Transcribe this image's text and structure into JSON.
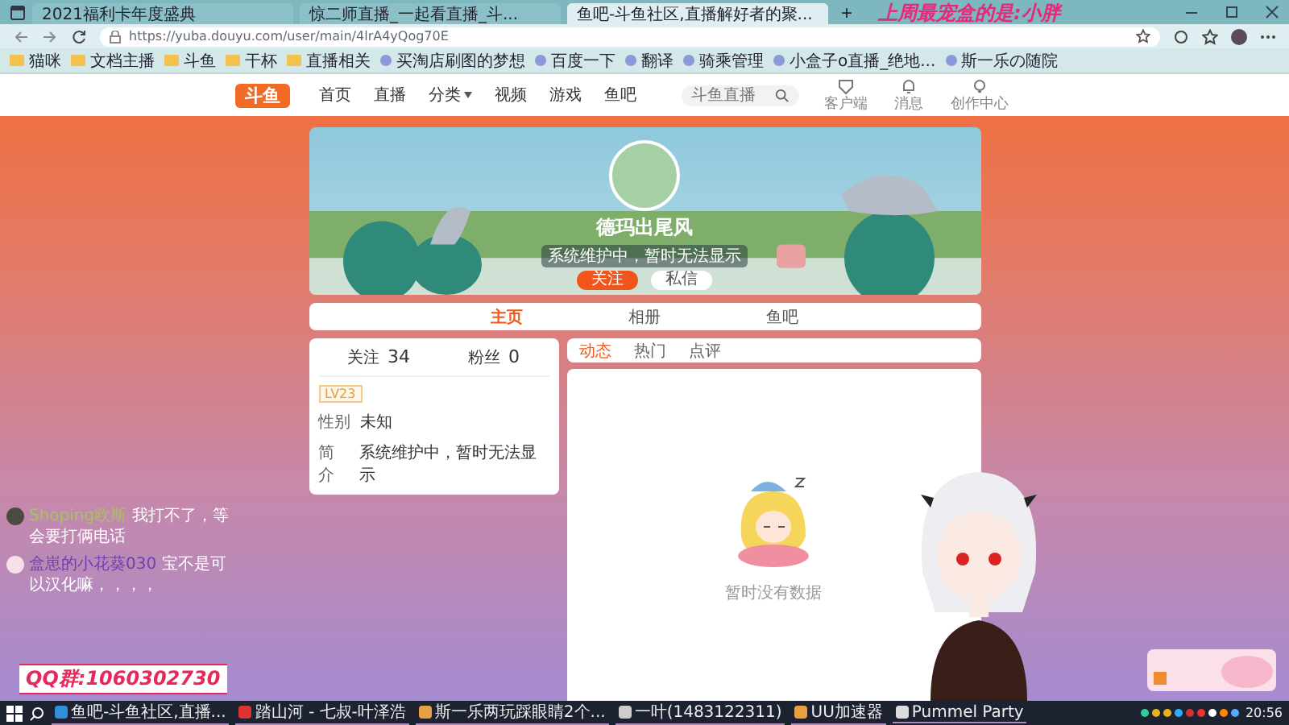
{
  "browser": {
    "tabs": [
      {
        "title": "2021福利卡年度盛典",
        "selected": false
      },
      {
        "title": "惊二师直播_一起看直播_斗...",
        "selected": false
      },
      {
        "title": "鱼吧-斗鱼社区,直播解好者的聚...",
        "selected": true
      }
    ],
    "new_tab": "+",
    "address": "https://yuba.douyu.com/user/main/4lrA4yQog70E",
    "bookmarks": [
      {
        "label": "猫咪",
        "kind": "folder"
      },
      {
        "label": "文档主播",
        "kind": "folder"
      },
      {
        "label": "斗鱼",
        "kind": "folder"
      },
      {
        "label": "干杯",
        "kind": "folder"
      },
      {
        "label": "直播相关",
        "kind": "folder"
      },
      {
        "label": "买淘店刷图的梦想",
        "kind": "site"
      },
      {
        "label": "百度一下",
        "kind": "site"
      },
      {
        "label": "翻译",
        "kind": "site"
      },
      {
        "label": "骑乘管理",
        "kind": "site"
      },
      {
        "label": "小盒子o直播_绝地...",
        "kind": "site"
      },
      {
        "label": "斯一乐の随院",
        "kind": "site"
      }
    ]
  },
  "overlay_title": "上周最宠盒的是:小胖",
  "site": {
    "logo": "斗鱼",
    "nav": [
      {
        "label": "首页",
        "dropdown": false
      },
      {
        "label": "直播",
        "dropdown": false
      },
      {
        "label": "分类",
        "dropdown": true
      },
      {
        "label": "视频",
        "dropdown": false
      },
      {
        "label": "游戏",
        "dropdown": false
      },
      {
        "label": "鱼吧",
        "dropdown": false
      }
    ],
    "search_placeholder": "斗鱼直播",
    "nav_icons": [
      {
        "label": "客户端",
        "kind": "client"
      },
      {
        "label": "消息",
        "kind": "bell"
      },
      {
        "label": "创作中心",
        "kind": "bulb"
      }
    ]
  },
  "profile": {
    "name": "德玛出尾风",
    "bio": "系统维护中，暂时无法显示",
    "buttons": [
      {
        "label": "关注",
        "primary": true
      },
      {
        "label": "私信",
        "primary": false
      }
    ]
  },
  "tabs": [
    {
      "label": "主页",
      "selected": true
    },
    {
      "label": "相册",
      "selected": false
    },
    {
      "label": "鱼吧",
      "selected": false
    }
  ],
  "stats": [
    {
      "label": "关注",
      "value": "34"
    },
    {
      "label": "粉丝",
      "value": "0"
    }
  ],
  "level_badge": "LV23",
  "info": [
    {
      "label": "性别",
      "value": "未知"
    },
    {
      "label": "简介",
      "value": "系统维护中，暂时无法显示"
    }
  ],
  "subtabs": [
    {
      "label": "动态",
      "selected": true
    },
    {
      "label": "热门",
      "selected": false
    },
    {
      "label": "点评",
      "selected": false
    }
  ],
  "empty_text": "暂时没有数据",
  "chat": [
    {
      "user": "Shoping欧斯",
      "text": "我打不了，等会要打俩电话"
    },
    {
      "user": "盒崽的小花葵030",
      "text": "宝不是可以汉化嘛，，，，"
    }
  ],
  "qq": "QQ群:1060302730",
  "taskbar": {
    "items": [
      {
        "label": "鱼吧-斗鱼社区,直播...",
        "kind": "browser"
      },
      {
        "label": "踏山河 - 七叔-叶泽浩",
        "kind": "music"
      },
      {
        "label": "斯一乐两玩踩眼睛2个...",
        "kind": "app"
      },
      {
        "label": "一叶(1483122311)",
        "kind": "chat"
      },
      {
        "label": "UU加速器",
        "kind": "app"
      },
      {
        "label": "Pummel Party",
        "kind": "game"
      }
    ],
    "clock": "20:56"
  }
}
